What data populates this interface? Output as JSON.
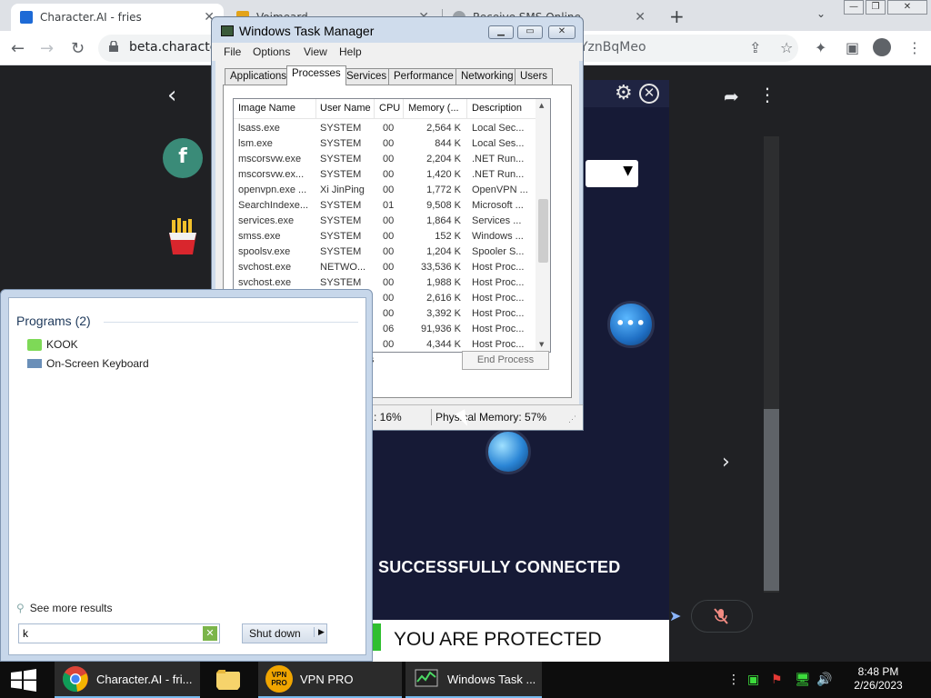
{
  "browser": {
    "tabs": [
      {
        "title": "Character.AI - fries",
        "active": true
      },
      {
        "title": "Voimeard",
        "active": false
      },
      {
        "title": "Receive SMS Online",
        "active": false
      }
    ],
    "new_tab_icon": "plus-icon",
    "url_start": "beta.characte",
    "url_end": "YznBqMeo"
  },
  "page": {
    "avatar_letter": "f"
  },
  "vpn": {
    "status": "SUCCESSFULLY CONNECTED",
    "protected": "YOU ARE PROTECTED",
    "chat_glyph": "•••",
    "close_glyph": "✕"
  },
  "task_manager": {
    "title": "Windows Task Manager",
    "menu": [
      "File",
      "Options",
      "View",
      "Help"
    ],
    "tabs": [
      "Applications",
      "Processes",
      "Services",
      "Performance",
      "Networking",
      "Users"
    ],
    "active_tab": "Processes",
    "columns": [
      "Image Name",
      "User Name",
      "CPU",
      "Memory (...",
      "Description"
    ],
    "rows": [
      [
        "lsass.exe",
        "SYSTEM",
        "00",
        "2,564 K",
        "Local Sec..."
      ],
      [
        "lsm.exe",
        "SYSTEM",
        "00",
        "844 K",
        "Local Ses..."
      ],
      [
        "mscorsvw.exe",
        "SYSTEM",
        "00",
        "2,204 K",
        ".NET Run..."
      ],
      [
        "mscorsvw.ex...",
        "SYSTEM",
        "00",
        "1,420 K",
        ".NET Run..."
      ],
      [
        "openvpn.exe ...",
        "Xi JinPing",
        "00",
        "1,772 K",
        "OpenVPN ..."
      ],
      [
        "SearchIndexe...",
        "SYSTEM",
        "01",
        "9,508 K",
        "Microsoft ..."
      ],
      [
        "services.exe",
        "SYSTEM",
        "00",
        "1,864 K",
        "Services ..."
      ],
      [
        "smss.exe",
        "SYSTEM",
        "00",
        "152 K",
        "Windows ..."
      ],
      [
        "spoolsv.exe",
        "SYSTEM",
        "00",
        "1,204 K",
        "Spooler S..."
      ],
      [
        "svchost.exe",
        "NETWO...",
        "00",
        "33,536 K",
        "Host Proc..."
      ],
      [
        "svchost.exe",
        "SYSTEM",
        "00",
        "1,988 K",
        "Host Proc..."
      ],
      [
        "",
        "",
        "00",
        "2,616 K",
        "Host Proc..."
      ],
      [
        "",
        "",
        "00",
        "3,392 K",
        "Host Proc..."
      ],
      [
        "",
        "",
        "06",
        "91,936 K",
        "Host Proc..."
      ],
      [
        "",
        "",
        "00",
        "4,344 K",
        "Host Proc..."
      ]
    ],
    "users_label": "ers",
    "end_process": "End Process",
    "cpu_usage": ": 16%",
    "physical_memory": "Physical Memory: 57%"
  },
  "start_menu": {
    "programs_heading": "Programs (2)",
    "programs": [
      "KOOK",
      "On-Screen Keyboard"
    ],
    "see_more": "See more results",
    "search_value": "k",
    "shutdown": "Shut down"
  },
  "taskbar": {
    "items": [
      {
        "label": "Character.AI - fri...",
        "icon": "chrome-icon"
      },
      {
        "label": "",
        "icon": "folder-icon"
      },
      {
        "label": "VPN PRO",
        "icon": "vpn-pro-icon",
        "icon_text": "VPN PRO"
      },
      {
        "label": "Windows Task ...",
        "icon": "task-manager-icon"
      }
    ],
    "time": "8:48 PM",
    "date": "2/26/2023"
  }
}
